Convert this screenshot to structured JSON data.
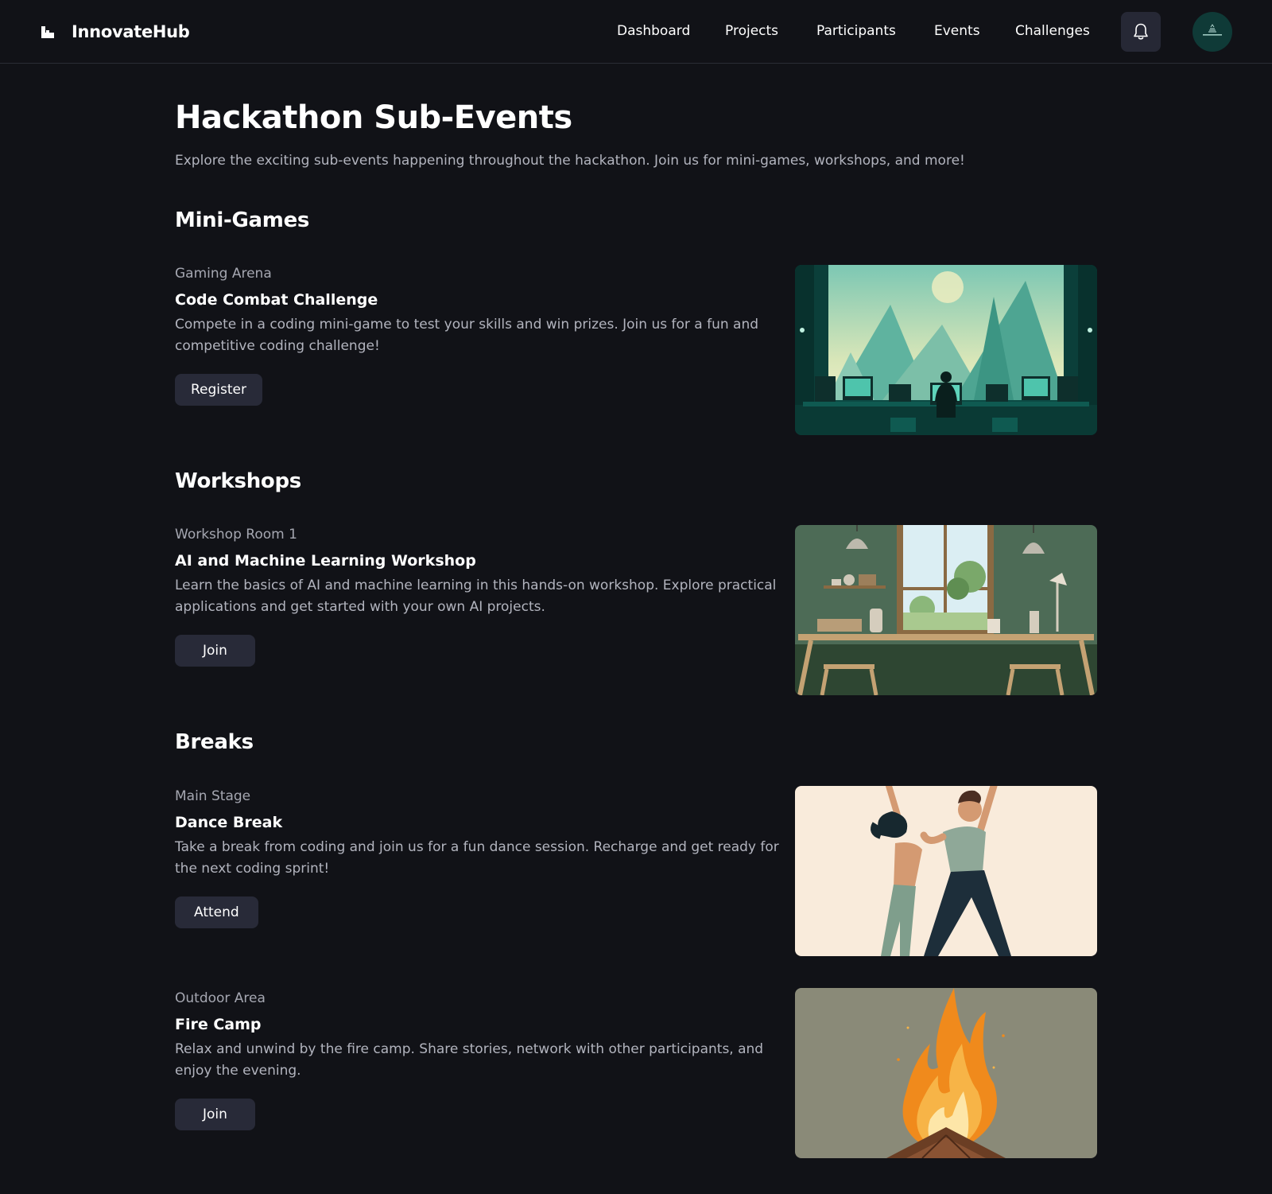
{
  "header": {
    "brand": "InnovateHub",
    "nav": [
      {
        "label": "Dashboard"
      },
      {
        "label": "Projects"
      },
      {
        "label": "Participants"
      },
      {
        "label": "Events"
      },
      {
        "label": "Challenges"
      }
    ],
    "notification_icon": "bell-icon",
    "avatar_icon": "avatar-logo"
  },
  "page": {
    "title": "Hackathon Sub-Events",
    "subtitle": "Explore the exciting sub-events happening throughout the hackathon. Join us for mini-games, workshops, and more!"
  },
  "sections": [
    {
      "title": "Mini-Games",
      "events": [
        {
          "location": "Gaming Arena",
          "title": "Code Combat Challenge",
          "description": "Compete in a coding mini-game to test your skills and win prizes. Join us for a fun and competitive coding challenge!",
          "button": "Register",
          "image": "gaming-arena-illustration"
        }
      ]
    },
    {
      "title": "Workshops",
      "events": [
        {
          "location": "Workshop Room 1",
          "title": "AI and Machine Learning Workshop",
          "description": "Learn the basics of AI and machine learning in this hands-on workshop. Explore practical applications and get started with your own AI projects.",
          "button": "Join",
          "image": "workshop-room-illustration"
        }
      ]
    },
    {
      "title": "Breaks",
      "events": [
        {
          "location": "Main Stage",
          "title": "Dance Break",
          "description": "Take a break from coding and join us for a fun dance session. Recharge and get ready for the next coding sprint!",
          "button": "Attend",
          "image": "dancing-couple-illustration"
        },
        {
          "location": "Outdoor Area",
          "title": "Fire Camp",
          "description": "Relax and unwind by the fire camp. Share stories, network with other participants, and enjoy the evening.",
          "button": "Join",
          "image": "campfire-illustration"
        }
      ]
    }
  ],
  "colors": {
    "background": "#111217",
    "button": "#282a38",
    "muted_text": "#b2b4be"
  }
}
